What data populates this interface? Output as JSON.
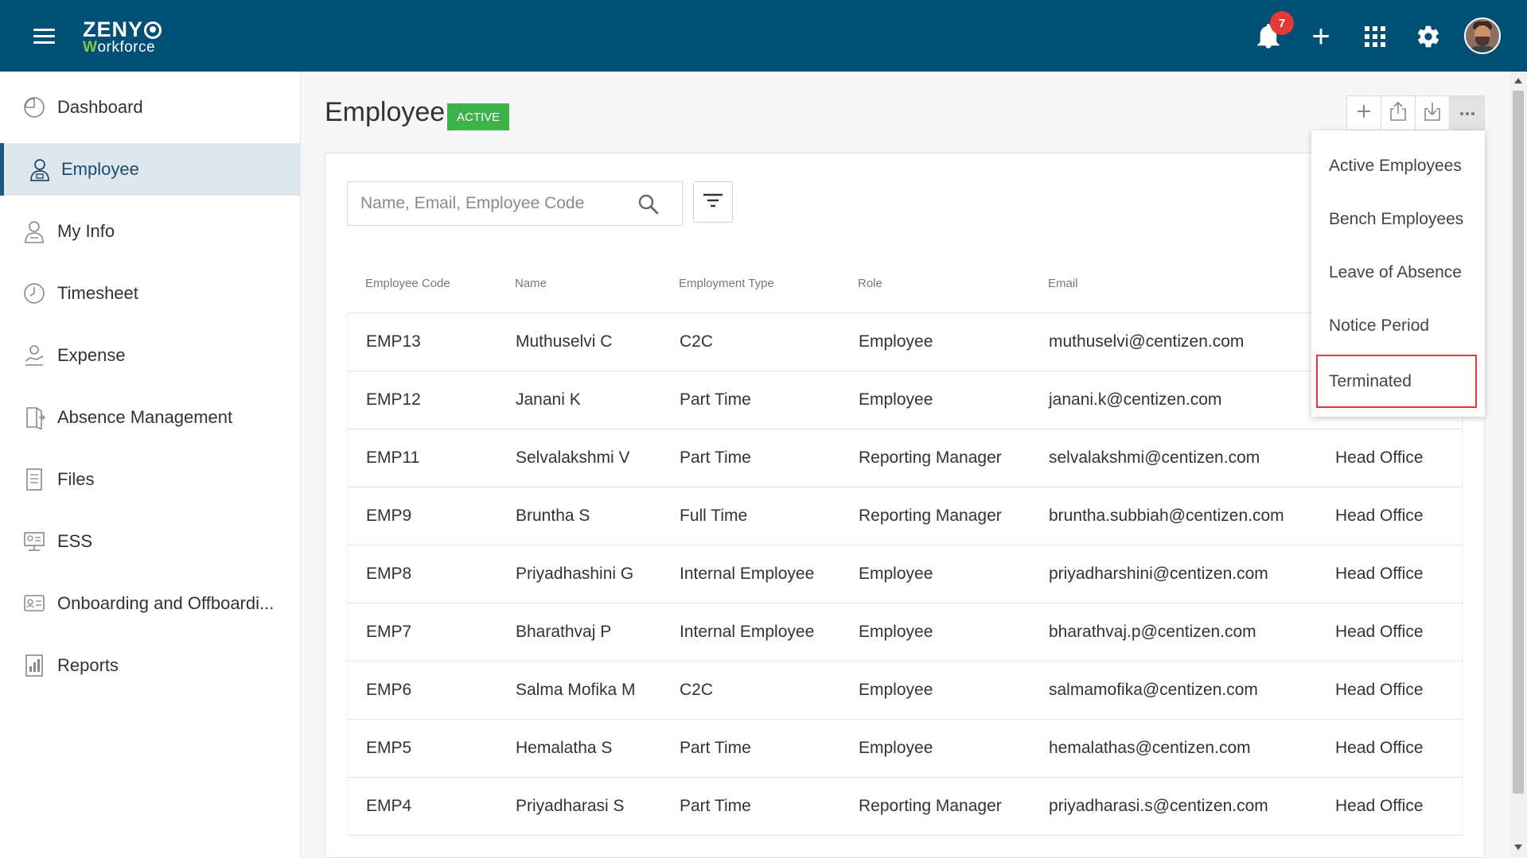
{
  "header": {
    "logo_top": "ZENY",
    "logo_bottom_accent": "W",
    "logo_bottom_rest": "orkforce",
    "notification_count": "7",
    "plus_label": "+"
  },
  "sidebar": {
    "items": [
      {
        "label": "Dashboard",
        "icon": "dashboard-icon"
      },
      {
        "label": "Employee",
        "icon": "employee-icon",
        "active": true
      },
      {
        "label": "My Info",
        "icon": "my-info-icon"
      },
      {
        "label": "Timesheet",
        "icon": "clock-icon"
      },
      {
        "label": "Expense",
        "icon": "expense-icon"
      },
      {
        "label": "Absence Management",
        "icon": "absence-icon"
      },
      {
        "label": "Files",
        "icon": "files-icon"
      },
      {
        "label": "ESS",
        "icon": "ess-icon"
      },
      {
        "label": "Onboarding and Offboardi...",
        "icon": "onboarding-icon"
      },
      {
        "label": "Reports",
        "icon": "reports-icon"
      }
    ]
  },
  "page": {
    "title": "Employee",
    "status": "Active"
  },
  "search": {
    "placeholder": "Name, Email, Employee Code"
  },
  "table": {
    "columns": [
      "Employee Code",
      "Name",
      "Employment Type",
      "Role",
      "Email"
    ],
    "rows": [
      [
        "EMP13",
        "Muthuselvi C",
        "C2C",
        "Employee",
        "muthuselvi@centizen.com",
        ""
      ],
      [
        "EMP12",
        "Janani K",
        "Part Time",
        "Employee",
        "janani.k@centizen.com",
        ""
      ],
      [
        "EMP11",
        "Selvalakshmi V",
        "Part Time",
        "Reporting Manager",
        "selvalakshmi@centizen.com",
        "Head Office"
      ],
      [
        "EMP9",
        "Bruntha S",
        "Full Time",
        "Reporting Manager",
        "bruntha.subbiah@centizen.com",
        "Head Office"
      ],
      [
        "EMP8",
        "Priyadhashini G",
        "Internal Employee",
        "Employee",
        "priyadharshini@centizen.com",
        "Head Office"
      ],
      [
        "EMP7",
        "Bharathvaj P",
        "Internal Employee",
        "Employee",
        "bharathvaj.p@centizen.com",
        "Head Office"
      ],
      [
        "EMP6",
        "Salma Mofika M",
        "C2C",
        "Employee",
        "salmamofika@centizen.com",
        "Head Office"
      ],
      [
        "EMP5",
        "Hemalatha S",
        "Part Time",
        "Employee",
        "hemalathas@centizen.com",
        "Head Office"
      ],
      [
        "EMP4",
        "Priyadharasi S",
        "Part Time",
        "Reporting Manager",
        "priyadharasi.s@centizen.com",
        "Head Office"
      ]
    ]
  },
  "dropdown": {
    "items": [
      "Active Employees",
      "Bench Employees",
      "Leave of Absence",
      "Notice Period",
      "Terminated"
    ],
    "selected": "Terminated"
  },
  "colors": {
    "header_bg": "#004f75",
    "active_badge": "#3db249",
    "selected_outline": "#e3333c",
    "notification_badge": "#e53935"
  }
}
